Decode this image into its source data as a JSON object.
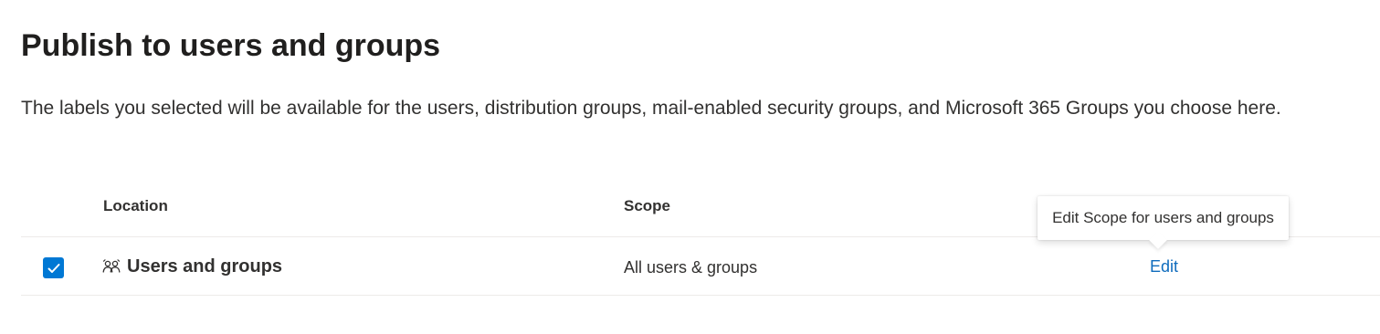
{
  "page": {
    "title": "Publish to users and groups",
    "description": "The labels you selected will be available for the users, distribution groups, mail-enabled security groups, and Microsoft 365 Groups you choose here."
  },
  "table": {
    "columns": {
      "location": "Location",
      "scope": "Scope"
    },
    "rows": [
      {
        "checked": true,
        "icon": "users-icon",
        "location": "Users and groups",
        "scope": "All users & groups",
        "action": "Edit"
      }
    ]
  },
  "tooltip": {
    "text": "Edit Scope for users and groups"
  },
  "colors": {
    "accent": "#0078d4",
    "link": "#0f6cbd",
    "text": "#323130",
    "divider": "#edebe9"
  }
}
